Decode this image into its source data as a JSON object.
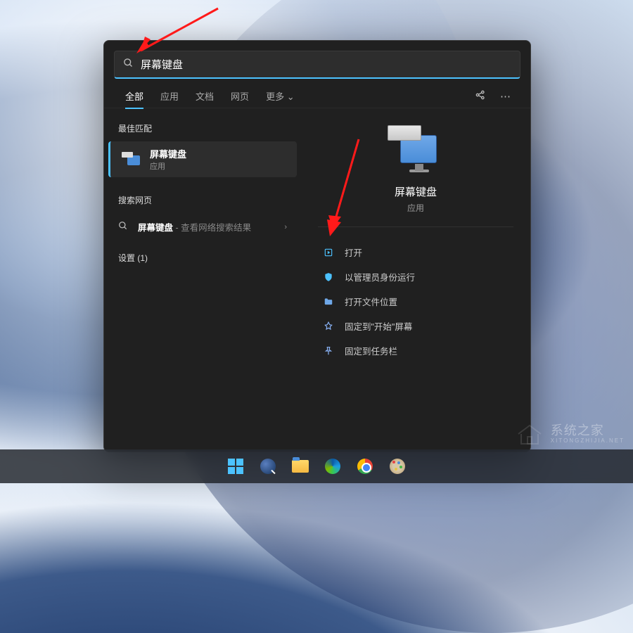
{
  "search": {
    "query": "屏幕键盘"
  },
  "tabs": {
    "all": "全部",
    "apps": "应用",
    "docs": "文档",
    "web": "网页",
    "more": "更多"
  },
  "left": {
    "best_match_header": "最佳匹配",
    "best_match": {
      "title": "屏幕键盘",
      "subtitle": "应用"
    },
    "search_web_header": "搜索网页",
    "web_item": {
      "term": "屏幕键盘",
      "suffix": " - 查看网络搜索结果"
    },
    "settings_header": "设置 (1)"
  },
  "right": {
    "app_title": "屏幕键盘",
    "app_subtitle": "应用",
    "actions": {
      "open": "打开",
      "run_admin": "以管理员身份运行",
      "open_location": "打开文件位置",
      "pin_start": "固定到\"开始\"屏幕",
      "pin_taskbar": "固定到任务栏"
    }
  },
  "watermark": {
    "title": "系统之家",
    "subtitle": "XITONGZHIJIA.NET"
  }
}
